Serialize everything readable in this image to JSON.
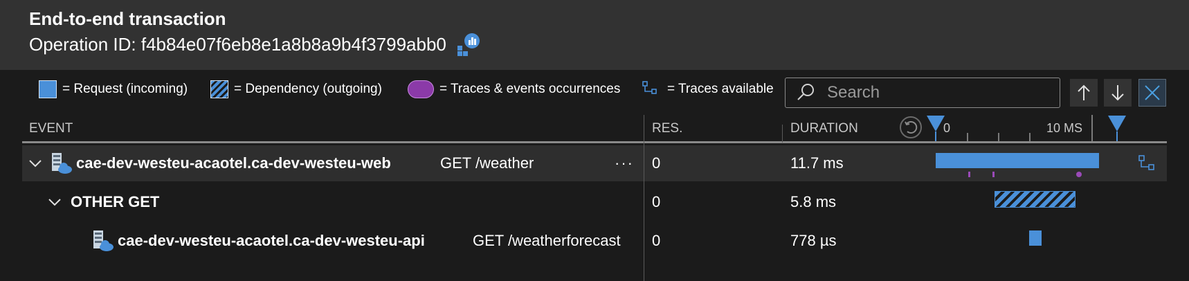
{
  "header": {
    "title": "End-to-end transaction",
    "operation_label": "Operation ID: f4b84e07f6eb8e1a8b8a9b4f3799abb0",
    "appinsights_icon": "application-insights-icon"
  },
  "legend": {
    "request": "= Request (incoming)",
    "dependency": "= Dependency (outgoing)",
    "traces": "= Traces & events occurrences",
    "available": "= Traces available"
  },
  "search": {
    "placeholder": "Search",
    "value": ""
  },
  "toolbar": {
    "up_icon": "arrow-up-icon",
    "down_icon": "arrow-down-icon",
    "close_icon": "close-icon"
  },
  "columns": {
    "event": "EVENT",
    "res": "RES.",
    "duration": "DURATION"
  },
  "timeline": {
    "start_label": "0",
    "mid_label": "10 MS",
    "range_start_ms": 0,
    "range_end_ms": 13
  },
  "rows": [
    {
      "name": "cae-dev-westeu-acaotel.ca-dev-westeu-web",
      "operation": "GET /weather",
      "more": "···",
      "res": "0",
      "duration": "11.7 ms",
      "start_ms": 0,
      "duration_ms": 11.7,
      "kind": "request",
      "trace_marks_ms": [
        2.4,
        4.1,
        10.2
      ]
    },
    {
      "name": "OTHER GET",
      "res": "0",
      "duration": "5.8 ms",
      "start_ms": 4.2,
      "duration_ms": 5.8,
      "kind": "dependency"
    },
    {
      "name": "cae-dev-westeu-acaotel.ca-dev-westeu-api",
      "operation": "GET /weatherforecast",
      "res": "0",
      "duration": "778 µs",
      "start_ms": 6.7,
      "duration_ms": 0.778,
      "kind": "request"
    }
  ]
}
